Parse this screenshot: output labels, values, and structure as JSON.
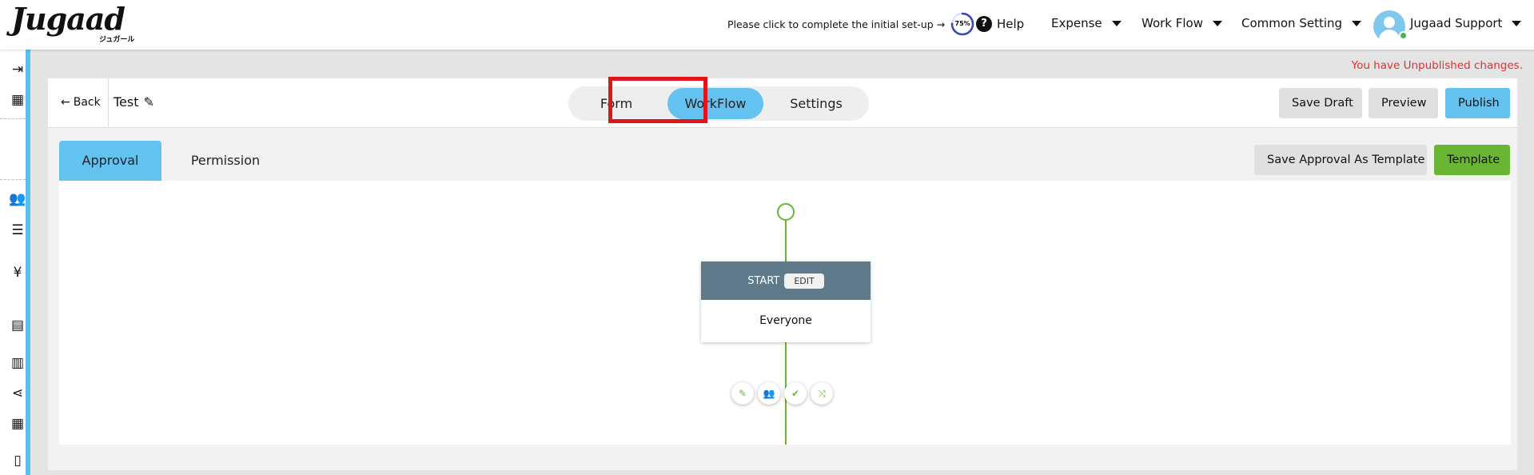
{
  "header": {
    "logo": "Jugaad",
    "logo_sub": "ジュガール",
    "setup_text": "Please click to complete the initial set-up →",
    "setup_progress_label": "75%",
    "setup_progress": 0.75,
    "help": "Help",
    "menus": [
      "Expense",
      "Work Flow",
      "Common Setting"
    ],
    "user_name": "Jugaad Support"
  },
  "notice": "You have Unpublished changes.",
  "editor": {
    "back": "Back",
    "title": "Test",
    "segments": [
      "Form",
      "WorkFlow",
      "Settings"
    ],
    "active_segment": "WorkFlow",
    "actions": {
      "save_draft": "Save Draft",
      "preview": "Preview",
      "publish": "Publish"
    }
  },
  "tabs": [
    "Approval",
    "Permission"
  ],
  "tab_actions": {
    "save_template": "Save Approval As Template",
    "template": "Template"
  },
  "workflow": {
    "start_label": "START",
    "edit_label": "EDIT",
    "assignee": "Everyone"
  },
  "colors": {
    "accent": "#64c2f1",
    "green": "#6ab534",
    "warning": "#e0302f",
    "highlight": "#e0141b",
    "card_header": "#5f7a8a"
  }
}
